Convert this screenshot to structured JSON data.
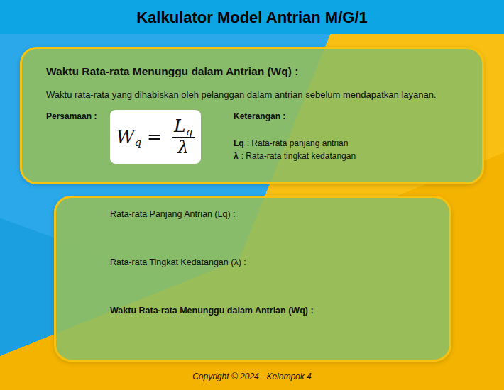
{
  "header": {
    "title": "Kalkulator Model Antrian M/G/1"
  },
  "definition": {
    "title": "Waktu Rata-rata Menunggu dalam Antrian (Wq) :",
    "description": "Waktu rata-rata yang dihabiskan oleh pelanggan dalam antrian sebelum mendapatkan layanan.",
    "equation_label": "Persamaan :",
    "formula": {
      "lhs": "W",
      "lhs_sub": "q",
      "equals": "=",
      "numerator": "L",
      "numerator_sub": "q",
      "denominator": "λ"
    },
    "notes_label": "Keterangan :",
    "notes": [
      {
        "symbol": "Lq",
        "text": ": Rata-rata panjang antrian"
      },
      {
        "symbol": "λ",
        "text": ": Rata-rata tingkat kedatangan"
      }
    ]
  },
  "calculator": {
    "fields": [
      {
        "label": "Rata-rata Panjang Antrian (Lq) :",
        "kind": "input"
      },
      {
        "label": "Rata-rata Tingkat Kedatangan (λ) :",
        "kind": "input"
      },
      {
        "label": "Waktu Rata-rata Menunggu dalam Antrian (Wq) :",
        "kind": "result"
      }
    ]
  },
  "footer": "Copyright © 2024 - Kelompok 4"
}
